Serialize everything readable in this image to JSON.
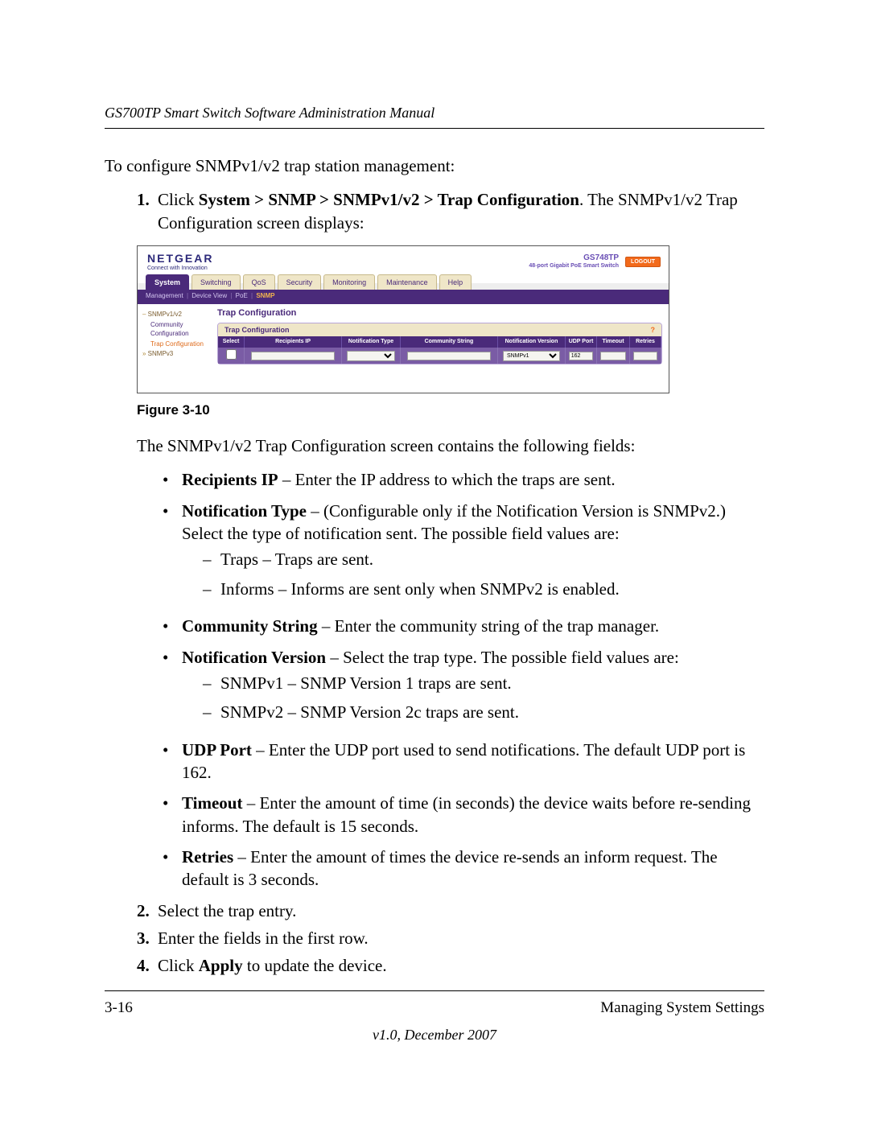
{
  "header": {
    "title": "GS700TP Smart Switch Software Administration Manual"
  },
  "intro": "To configure SNMPv1/v2 trap station management:",
  "step1": {
    "num": "1.",
    "pre": "Click ",
    "path": "System > SNMP > SNMPv1/v2 > Trap Configuration",
    "post": ". The SNMPv1/v2 Trap Configuration screen displays:"
  },
  "figure": {
    "brand": "NETGEAR",
    "brand_tag": "Connect with Innovation",
    "model": "GS748TP",
    "model_sub": "48-port Gigabit PoE Smart Switch",
    "logout": "LOGOUT",
    "tabs": [
      "System",
      "Switching",
      "QoS",
      "Security",
      "Monitoring",
      "Maintenance",
      "Help"
    ],
    "breadcrumb": [
      "Management",
      "Device View",
      "PoE",
      "SNMP"
    ],
    "sidebar": {
      "group1": "SNMPv1/v2",
      "items": [
        "Community Configuration",
        "Trap Configuration"
      ],
      "group2": "SNMPv3"
    },
    "panel_title": "Trap Configuration",
    "panel_sub": "Trap Configuration",
    "qmark": "?",
    "columns": [
      "Select",
      "Recipients IP",
      "Notification Type",
      "Community String",
      "Notification Version",
      "UDP Port",
      "Timeout",
      "Retries"
    ],
    "row": {
      "notif_version_value": "SNMPv1",
      "udp_port_value": "162"
    }
  },
  "figure_caption": "Figure 3-10",
  "after_figure": "The SNMPv1/v2 Trap Configuration screen contains the following fields:",
  "fields": {
    "recipients": {
      "label": "Recipients IP",
      "text": " – Enter the IP address to which the traps are sent."
    },
    "notif_type": {
      "label": "Notification Type",
      "text": " – (Configurable only if the Notification Version is SNMPv2.) Select the type of notification sent. The possible field values are:",
      "sub": [
        "Traps – Traps are sent.",
        "Informs – Informs are sent only when SNMPv2 is enabled."
      ]
    },
    "community": {
      "label": "Community String",
      "text": " – Enter the community string of the trap manager."
    },
    "notif_ver": {
      "label": "Notification Version",
      "text": " – Select the trap type. The possible field values are:",
      "sub": [
        "SNMPv1 – SNMP Version 1 traps are sent.",
        "SNMPv2 – SNMP Version 2c traps are sent."
      ]
    },
    "udp": {
      "label": "UDP Port",
      "text": " – Enter the UDP port used to send notifications. The default UDP port is 162."
    },
    "timeout": {
      "label": "Timeout",
      "text": " – Enter the amount of time (in seconds) the device waits before re-sending informs. The default is 15 seconds."
    },
    "retries": {
      "label": "Retries",
      "text": " – Enter the amount of times the device re-sends an inform request. The default is 3 seconds."
    }
  },
  "steps_after": [
    {
      "num": "2.",
      "bold": "",
      "text": "Select the trap entry."
    },
    {
      "num": "3.",
      "bold": "",
      "text": "Enter the fields in the first row."
    }
  ],
  "step4": {
    "num": "4.",
    "pre": "Click ",
    "bold": "Apply",
    "post": " to update the device."
  },
  "footer": {
    "page": "3-16",
    "section": "Managing System Settings",
    "version": "v1.0, December 2007"
  }
}
